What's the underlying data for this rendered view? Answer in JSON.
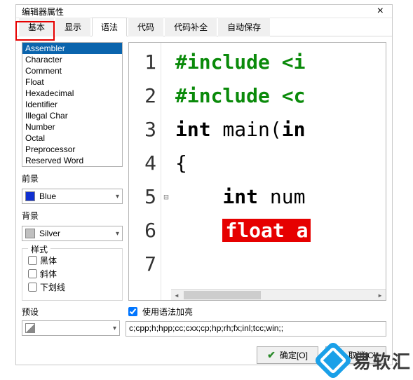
{
  "window": {
    "title": "编辑器属性"
  },
  "tabs": {
    "items": [
      {
        "label": "基本"
      },
      {
        "label": "显示"
      },
      {
        "label": "语法",
        "active": true
      },
      {
        "label": "代码"
      },
      {
        "label": "代码补全"
      },
      {
        "label": "自动保存"
      }
    ]
  },
  "tokenList": {
    "items": [
      {
        "label": "Assembler",
        "selected": true
      },
      {
        "label": "Character"
      },
      {
        "label": "Comment"
      },
      {
        "label": "Float"
      },
      {
        "label": "Hexadecimal"
      },
      {
        "label": "Identifier"
      },
      {
        "label": "Illegal Char"
      },
      {
        "label": "Number"
      },
      {
        "label": "Octal"
      },
      {
        "label": "Preprocessor"
      },
      {
        "label": "Reserved Word"
      }
    ]
  },
  "foreground": {
    "label": "前景",
    "value": "Blue",
    "color": "#1030d0"
  },
  "background": {
    "label": "背景",
    "value": "Silver",
    "color": "#c0c0c0"
  },
  "style": {
    "legend": "样式",
    "bold": {
      "label": "黑体",
      "checked": false
    },
    "italic": {
      "label": "斜体",
      "checked": false
    },
    "underline": {
      "label": "下划线",
      "checked": false
    }
  },
  "preview": {
    "lines": [
      {
        "n": "1",
        "cls": "pp",
        "text": "#include <i"
      },
      {
        "n": "2",
        "cls": "pp",
        "text": "#include <c"
      },
      {
        "n": "3",
        "cls": "plain",
        "text": ""
      },
      {
        "n": "4",
        "cls": "",
        "html": true,
        "kw1": "int",
        "mid": " main(",
        "kw2": "in"
      },
      {
        "n": "5",
        "cls": "plain",
        "text": "{",
        "fold": "⊟"
      },
      {
        "n": "6",
        "cls": "",
        "html6": true,
        "indent": "    ",
        "kw": "int",
        "rest": " num"
      },
      {
        "n": "7",
        "cls": "",
        "html7": true,
        "indent": "    ",
        "hl": "float a"
      }
    ]
  },
  "syntaxHighlight": {
    "label": "使用语法加亮",
    "checked": true
  },
  "preset": {
    "label": "预设"
  },
  "extensions": {
    "value": "c;cpp;h;hpp;cc;cxx;cp;hp;rh;fx;inl;tcc;win;;"
  },
  "buttons": {
    "ok": "确定[O]",
    "cancel": "取消[C]"
  },
  "watermark": {
    "text": "易软汇"
  }
}
